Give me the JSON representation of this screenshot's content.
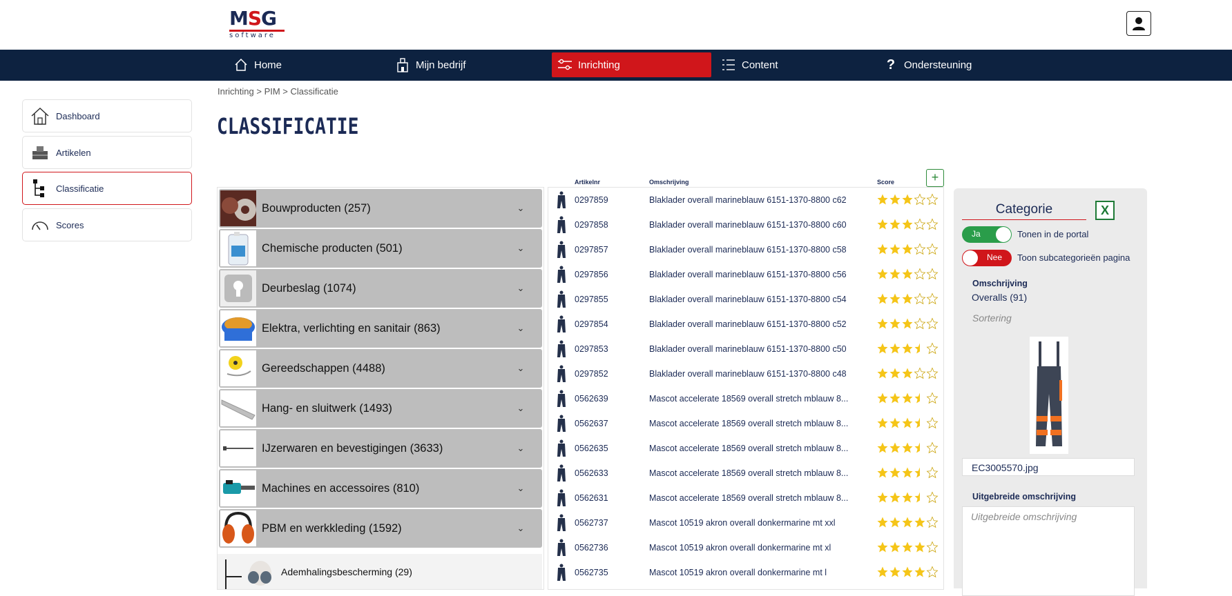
{
  "brand": {
    "logo_main": "MSG",
    "logo_sub": "software"
  },
  "nav": {
    "items": [
      {
        "label": "Home",
        "icon": "house-icon"
      },
      {
        "label": "Mijn bedrijf",
        "icon": "company-icon"
      },
      {
        "label": "Inrichting",
        "icon": "sliders-icon",
        "active": true
      },
      {
        "label": "Content",
        "icon": "list-icon"
      },
      {
        "label": "Ondersteuning",
        "icon": "question-icon"
      }
    ]
  },
  "sidebar": {
    "items": [
      {
        "label": "Dashboard",
        "icon": "house-icon"
      },
      {
        "label": "Artikelen",
        "icon": "box-icon"
      },
      {
        "label": "Classificatie",
        "icon": "tree-icon",
        "active": true
      },
      {
        "label": "Scores",
        "icon": "gauge-icon"
      }
    ]
  },
  "breadcrumb": "Inrichting > PIM > Classificatie",
  "page_title": "CLASSIFICATIE",
  "categories": [
    {
      "label": "Bouwproducten (257)"
    },
    {
      "label": "Chemische producten (501)"
    },
    {
      "label": "Deurbeslag (1074)"
    },
    {
      "label": "Elektra, verlichting en sanitair (863)"
    },
    {
      "label": "Gereedschappen (4488)"
    },
    {
      "label": "Hang- en sluitwerk (1493)"
    },
    {
      "label": "IJzerwaren en bevestigingen (3633)"
    },
    {
      "label": "Machines en accessoires (810)"
    },
    {
      "label": "PBM en werkkleding (1592)"
    }
  ],
  "subcategory": {
    "label": "Ademhalingsbescherming (29)"
  },
  "table": {
    "headers": {
      "nr": "Artikelnr",
      "desc": "Omschrijving",
      "score": "Score"
    },
    "add_label": "+",
    "rows": [
      {
        "nr": "0297859",
        "desc": "Blaklader overall marineblauw 6151-1370-8800 c62",
        "score": 3
      },
      {
        "nr": "0297858",
        "desc": "Blaklader overall marineblauw 6151-1370-8800 c60",
        "score": 3
      },
      {
        "nr": "0297857",
        "desc": "Blaklader overall marineblauw 6151-1370-8800 c58",
        "score": 3
      },
      {
        "nr": "0297856",
        "desc": "Blaklader overall marineblauw 6151-1370-8800 c56",
        "score": 3
      },
      {
        "nr": "0297855",
        "desc": "Blaklader overall marineblauw 6151-1370-8800 c54",
        "score": 3
      },
      {
        "nr": "0297854",
        "desc": "Blaklader overall marineblauw 6151-1370-8800 c52",
        "score": 3
      },
      {
        "nr": "0297853",
        "desc": "Blaklader overall marineblauw 6151-1370-8800 c50",
        "score": 3.5
      },
      {
        "nr": "0297852",
        "desc": "Blaklader overall marineblauw 6151-1370-8800 c48",
        "score": 3
      },
      {
        "nr": "0562639",
        "desc": "Mascot accelerate 18569 overall stretch mblauw 8...",
        "score": 3.5
      },
      {
        "nr": "0562637",
        "desc": "Mascot accelerate 18569 overall stretch mblauw 8...",
        "score": 3.5
      },
      {
        "nr": "0562635",
        "desc": "Mascot accelerate 18569 overall stretch mblauw 8...",
        "score": 3.5
      },
      {
        "nr": "0562633",
        "desc": "Mascot accelerate 18569 overall stretch mblauw 8...",
        "score": 3.5
      },
      {
        "nr": "0562631",
        "desc": "Mascot accelerate 18569 overall stretch mblauw 8...",
        "score": 3.5
      },
      {
        "nr": "0562737",
        "desc": "Mascot 10519 akron overall donkermarine mt xxl",
        "score": 4
      },
      {
        "nr": "0562736",
        "desc": "Mascot 10519 akron overall donkermarine mt xl",
        "score": 4
      },
      {
        "nr": "0562735",
        "desc": "Mascot 10519 akron overall donkermarine mt l",
        "score": 4
      }
    ]
  },
  "detail": {
    "heading": "Categorie",
    "excel_label": "X",
    "toggle_portal": {
      "state": "Ja",
      "text": "Tonen in de portal"
    },
    "toggle_sub": {
      "state": "Nee",
      "text": "Toon subcategorieën pagina"
    },
    "omschrijving_label": "Omschrijving",
    "omschrijving_value": "Overalls (91)",
    "sortering_placeholder": "Sortering",
    "filename": "EC3005570.jpg",
    "uitgebreide_label": "Uitgebreide omschrijving",
    "uitgebreide_placeholder": "Uitgebreide omschrijving"
  },
  "colors": {
    "navy": "#0d2240",
    "accent_red": "#d0161b",
    "toggle_green": "#2a9d4a",
    "star": "#f5c518"
  }
}
